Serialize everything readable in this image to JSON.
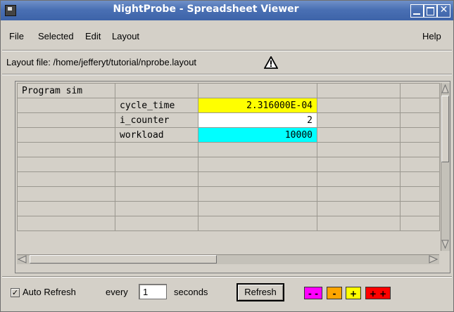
{
  "window": {
    "title": "NightProbe - Spreadsheet Viewer",
    "icons": [
      "app-icon",
      "minimize-icon",
      "maximize-icon",
      "close-icon"
    ]
  },
  "menu": {
    "file": "File",
    "selected": "Selected",
    "edit": "Edit",
    "layout": "Layout",
    "help": "Help"
  },
  "layout_file": {
    "label": "Layout file: /home/jefferyt/tutorial/nprobe.layout",
    "icon": "warning-icon"
  },
  "grid": {
    "rows": [
      [
        "Program sim",
        "",
        "",
        "",
        ""
      ],
      [
        "",
        "cycle_time",
        "2.316000E-04",
        "",
        ""
      ],
      [
        "",
        "i_counter",
        "2",
        "",
        ""
      ],
      [
        "",
        "workload",
        "10000",
        "",
        ""
      ],
      [
        "",
        "",
        "",
        "",
        ""
      ],
      [
        "",
        "",
        "",
        "",
        ""
      ],
      [
        "",
        "",
        "",
        "",
        ""
      ],
      [
        "",
        "",
        "",
        "",
        ""
      ],
      [
        "",
        "",
        "",
        "",
        ""
      ],
      [
        "",
        "",
        "",
        "",
        ""
      ]
    ],
    "value_colors": [
      "#ffff00",
      "#ffffff",
      "#00ffff"
    ]
  },
  "bottom": {
    "auto_refresh_checked": true,
    "auto_refresh_label": "Auto Refresh",
    "every_label": "every",
    "interval": "1",
    "seconds_label": "seconds",
    "refresh_button": "Refresh",
    "limits": [
      {
        "label": "- -",
        "color": "#ff00ff"
      },
      {
        "label": "-",
        "color": "#ffa500"
      },
      {
        "label": "+",
        "color": "#ffff00"
      },
      {
        "label": "+ +",
        "color": "#ff0000"
      }
    ]
  }
}
